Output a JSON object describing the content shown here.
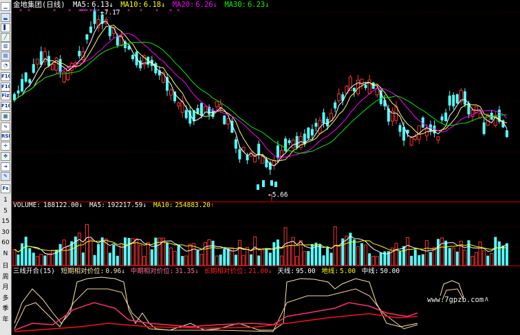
{
  "toolbar": {
    "icon_buttons": [
      "chart-line-icon",
      "chart-bar-icon",
      "chart-candle-icon",
      "chart-area-icon",
      "kline-icon",
      "window-icon",
      "chart-pie-icon",
      "F10",
      "F10",
      "Fiz",
      "F10",
      "chart-grid-icon",
      "chart-wave-icon",
      "RSI",
      "cross-icon",
      "move-icon",
      "arrow-right-icon",
      "pencil-icon"
    ],
    "fs_label": "Fs",
    "period_numbers": [
      "1",
      "5",
      "15",
      "30",
      "60"
    ],
    "period_letters": [
      "N",
      "日",
      "周",
      "月",
      "多",
      "季",
      "年"
    ]
  },
  "price_panel": {
    "name": "金地集团",
    "period": "(日线)",
    "ma5": {
      "label": "MA5:",
      "value": "6.13",
      "arrow": "↓",
      "color": "#ffffff"
    },
    "ma10": {
      "label": "MA10:",
      "value": "6.18",
      "arrow": "↓",
      "color": "#ffff00"
    },
    "ma20": {
      "label": "MA20:",
      "value": "6.26",
      "arrow": "↓",
      "color": "#ff00ff"
    },
    "ma30": {
      "label": "MA30:",
      "value": "6.23",
      "arrow": "↓",
      "color": "#00ff00"
    },
    "high_label": "7.17",
    "low_label": "5.66"
  },
  "volume_panel": {
    "label": "VOLUME:",
    "value": "188122.00",
    "arrow": "↓",
    "ma5_label": "MA5:",
    "ma5_value": "192217.59",
    "ma5_arrow": "↓",
    "ma10_label": "MA10:",
    "ma10_value": "254883.20",
    "ma10_arrow": "↑"
  },
  "indicator_panel": {
    "name": "三线开合(15)",
    "short_label": "短期相对价位:",
    "short_value": "0.96",
    "short_arrow": "↓",
    "mid_label": "中期相对价位:",
    "mid_value": "31.35",
    "mid_arrow": "↓",
    "long_label": "长期相对价位:",
    "long_value": "21.00",
    "long_arrow": "↓",
    "sky_label": "天线:",
    "sky_value": "95.00",
    "ground_label": "地线:",
    "ground_value": "5.00",
    "center_label": "中线:",
    "center_value": "50.00"
  },
  "watermark": "www.7gpzb.com",
  "colors": {
    "up": "#ff3030",
    "down": "#54ffff",
    "grid": "#8b0000",
    "separator": "#d00000",
    "white_line": "#ffffff",
    "yellow_line": "#ffff66",
    "magenta_line": "#ff00ff",
    "green_line": "#00ee00",
    "pink_line": "#ff3070",
    "cream_line": "#ffe8b0"
  }
}
